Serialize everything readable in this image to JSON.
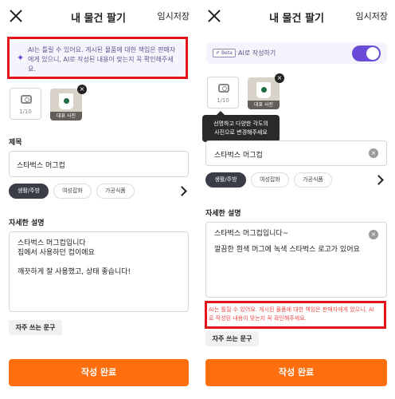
{
  "header": {
    "title": "내 물건 팔기",
    "save_label": "임시저장"
  },
  "left": {
    "notice_text": "AI는 틀릴 수 있어요. 게시된 물품에 대한 책임은 판매자에게 있으니, AI로 작성된 내용이 맞는지 꼭 확인해주세요.",
    "photo_count": "1/10",
    "thumb_label": "대표 사진",
    "title_label": "제목",
    "title_value": "스타벅스 머그컵",
    "categories": [
      "생활/주방",
      "여성잡화",
      "가공식품"
    ],
    "desc_label": "자세한 설명",
    "desc_lines": [
      "스타벅스 머그컵입니다",
      "집에서 사용하던 컵이에요",
      "",
      "깨끗하게 잘 사용했고, 상태 좋습니다!"
    ],
    "freq_label": "자주 쓰는 문구",
    "submit_label": "작성 완료"
  },
  "right": {
    "beta_label": "Beta",
    "ai_label": "AI로 작성하기",
    "photo_count": "1/10",
    "thumb_label": "대표 사진",
    "tooltip_lines": [
      "선명하고 다양한 각도의",
      "사진으로 변경해주세요"
    ],
    "title_value": "스타벅스 머그컵",
    "categories": [
      "생활/주방",
      "여성잡화",
      "가공식품"
    ],
    "desc_label": "자세한 설명",
    "desc_lines": [
      "스타벅스 머그컵입니다~",
      "",
      "깔끔한 흰색 머그에 녹색 스타벅스 로고가 있어요"
    ],
    "warning_text": "AI는 틀릴 수 있어요. 게시된 물품에 대한 책임은 판매자에게 있으니, AI로 작성된 내용이 맞는지 꼭 확인해주세요.",
    "freq_label": "자주 쓰는 문구",
    "submit_label": "작성 완료"
  },
  "colors": {
    "accent_orange": "#ff6f0f",
    "ai_purple": "#6a4bd8",
    "highlight_red": "#e4141b",
    "warning_red": "#ef4b4b"
  },
  "icons": [
    "close-icon",
    "sparkle-icon",
    "camera-icon",
    "remove-photo-icon",
    "clear-icon",
    "chevron-right-icon"
  ]
}
